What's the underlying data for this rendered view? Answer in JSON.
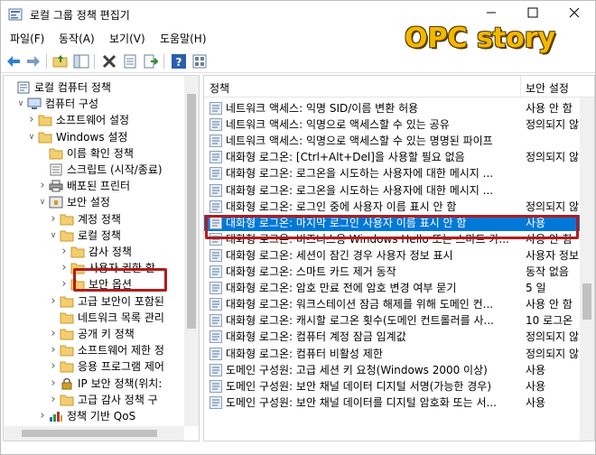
{
  "window": {
    "title": "로컬 그룹 정책 편집기",
    "watermark": "OPC story"
  },
  "menu": [
    "파일(F)",
    "동작(A)",
    "보기(V)",
    "도움말(H)"
  ],
  "toolbar_icons": [
    "back-arrow-icon",
    "forward-arrow-icon",
    "folder-up-icon",
    "show-hide-tree-icon",
    "delete-icon",
    "properties-icon",
    "export-list-icon",
    "help-icon",
    "view-icon"
  ],
  "tree": [
    {
      "label": "로컬 컴퓨터 정책",
      "level": 0,
      "icon": "computer-policy-icon",
      "expander": ""
    },
    {
      "label": "컴퓨터 구성",
      "level": 1,
      "icon": "computer-icon",
      "expander": "open"
    },
    {
      "label": "소프트웨어 설정",
      "level": 2,
      "icon": "folder-icon",
      "expander": "closed"
    },
    {
      "label": "Windows 설정",
      "level": 2,
      "icon": "folder-icon",
      "expander": "open"
    },
    {
      "label": "이름 확인 정책",
      "level": 3,
      "icon": "folder-icon",
      "expander": ""
    },
    {
      "label": "스크립트 (시작/종료)",
      "level": 3,
      "icon": "script-icon",
      "expander": ""
    },
    {
      "label": "배포된 프린터",
      "level": 3,
      "icon": "printer-icon",
      "expander": "closed"
    },
    {
      "label": "보안 설정",
      "level": 3,
      "icon": "security-settings-icon",
      "expander": "open"
    },
    {
      "label": "계정 정책",
      "level": 4,
      "icon": "folder-icon",
      "expander": "closed"
    },
    {
      "label": "로컬 정책",
      "level": 4,
      "icon": "folder-icon",
      "expander": "open"
    },
    {
      "label": "감사 정책",
      "level": 5,
      "icon": "folder-icon",
      "expander": "closed"
    },
    {
      "label": "사용자 권한 할",
      "level": 5,
      "icon": "folder-icon",
      "expander": "closed"
    },
    {
      "label": "보안 옵션",
      "level": 5,
      "icon": "folder-icon",
      "expander": "closed"
    },
    {
      "label": "고급 보안이 포함된",
      "level": 4,
      "icon": "folder-icon",
      "expander": "closed"
    },
    {
      "label": "네트워크 목록 관리",
      "level": 4,
      "icon": "folder-icon",
      "expander": ""
    },
    {
      "label": "공개 키 정책",
      "level": 4,
      "icon": "folder-icon",
      "expander": "closed"
    },
    {
      "label": "소프트웨어 제한 정",
      "level": 4,
      "icon": "folder-icon",
      "expander": "closed"
    },
    {
      "label": "응용 프로그램 제어",
      "level": 4,
      "icon": "folder-icon",
      "expander": "closed"
    },
    {
      "label": "IP 보안 정책(위치:",
      "level": 4,
      "icon": "ip-security-icon",
      "expander": "closed"
    },
    {
      "label": "고급 감사 정책 구",
      "level": 4,
      "icon": "folder-icon",
      "expander": "closed"
    },
    {
      "label": "정책 기반 QoS",
      "level": 3,
      "icon": "qos-chart-icon",
      "expander": "closed"
    }
  ],
  "list": {
    "headers": {
      "policy": "정책",
      "setting": "보안 설정"
    },
    "rows": [
      {
        "name": "네트워크 액세스: 익명 SID/이름 변환 허용",
        "value": "사용 안 함"
      },
      {
        "name": "네트워크 액세스: 익명으로 액세스할 수 있는 공유",
        "value": "정의되지 않"
      },
      {
        "name": "네트워크 액세스: 익명으로 액세스할 수 있는 명명된 파이프",
        "value": ""
      },
      {
        "name": "대화형 로그온: [Ctrl+Alt+Del]을 사용할 필요 없음",
        "value": "정의되지 않"
      },
      {
        "name": "대화형 로그온: 로그온을 시도하는 사용자에 대한 메시지 ...",
        "value": ""
      },
      {
        "name": "대화형 로그온: 로그온을 시도하는 사용자에 대한 메시지 ...",
        "value": ""
      },
      {
        "name": "대화형 로그온: 로그인 중에 사용자 이름 표시 안 함",
        "value": "정의되지 않"
      },
      {
        "name": "대화형 로그온: 마지막 로그인 사용자 이름 표시 안 함",
        "value": "사용"
      },
      {
        "name": "대화형 로그온: 비즈니스용 Windows Hello 또는 스마트 카...",
        "value": "사용 안 함"
      },
      {
        "name": "대화형 로그온: 세션이 잠긴 경우 사용자 정보 표시",
        "value": "사용자 정보"
      },
      {
        "name": "대화형 로그온: 스마트 카드 제거 동작",
        "value": "동작 없음"
      },
      {
        "name": "대화형 로그온: 암호 만료 전에 암호 변경 여부 묻기",
        "value": "5 일"
      },
      {
        "name": "대화형 로그온: 워크스테이션 잠금 해제를 위해 도메인 컨...",
        "value": "사용 안 함"
      },
      {
        "name": "대화형 로그온: 캐시할 로그온 횟수(도메인 컨트롤러를 사...",
        "value": "10 로그온"
      },
      {
        "name": "대화형 로그온: 컴퓨터 계정 잠금 임계값",
        "value": "정의되지 않"
      },
      {
        "name": "대화형 로그온: 컴퓨터 비활성 제한",
        "value": "정의되지 않"
      },
      {
        "name": "도메인 구성원: 고급 세션 키 요청(Windows 2000 이상)",
        "value": "사용"
      },
      {
        "name": "도메인 구성원: 보안 채널 데이터 디지털 서명(가능한 경우)",
        "value": "사용"
      },
      {
        "name": "도메인 구성원: 보안 채널 데이터를 디지털 암호화 또는 서...",
        "value": "사용"
      }
    ]
  },
  "selected_row": 7,
  "highlight_color": "#b31b1b",
  "selection_color": "#0078d7"
}
